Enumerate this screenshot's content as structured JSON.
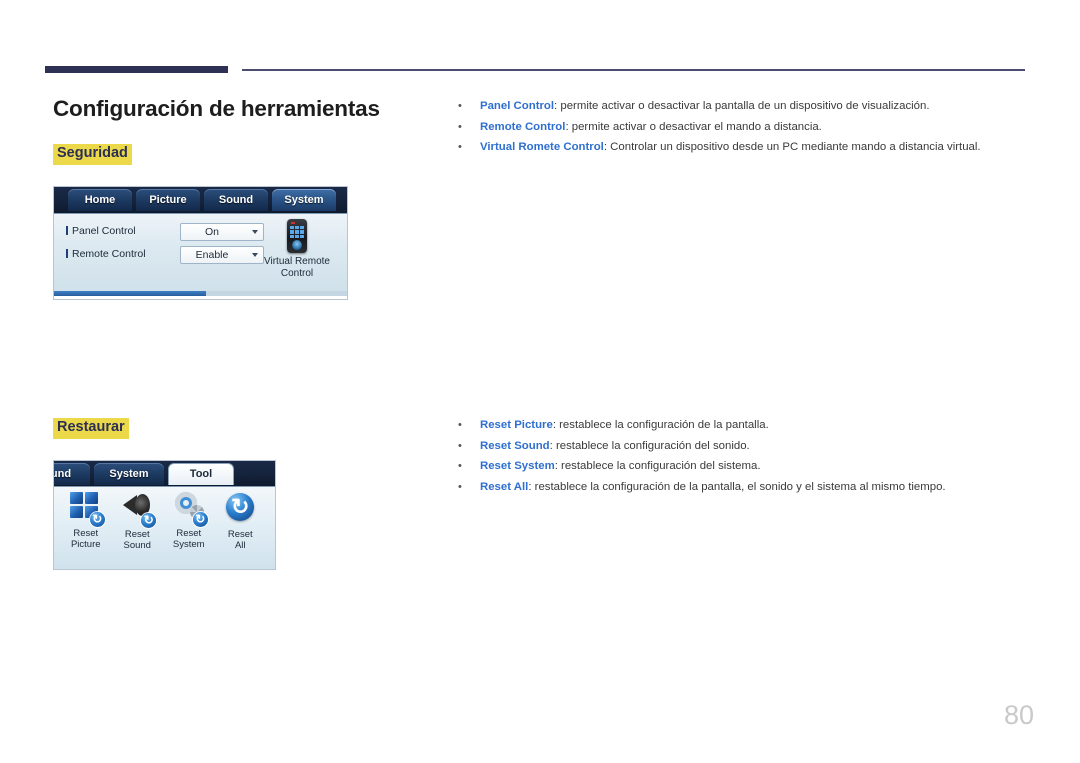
{
  "document": {
    "page_number": "80",
    "title": "Configuración de herramientas"
  },
  "sections": [
    {
      "label": "Seguridad",
      "bullets": [
        {
          "term": "Panel Control",
          "desc": ": permite activar o desactivar la pantalla de un dispositivo de visualización."
        },
        {
          "term": "Remote Control",
          "desc": ": permite activar o desactivar el mando a distancia."
        },
        {
          "term": "Virtual Romete Control",
          "desc": ": Controlar un dispositivo desde un PC mediante mando a distancia virtual."
        }
      ]
    },
    {
      "label": "Restaurar",
      "bullets": [
        {
          "term": "Reset Picture",
          "desc": ": restablece la configuración de la pantalla."
        },
        {
          "term": "Reset Sound",
          "desc": ": restablece la configuración del sonido."
        },
        {
          "term": "Reset System",
          "desc": ": restablece la configuración del sistema."
        },
        {
          "term": "Reset All",
          "desc": ": restablece la configuración de la pantalla, el sonido y el sistema al mismo tiempo."
        }
      ]
    }
  ],
  "screenshot_security": {
    "tabs": [
      {
        "label": "Home",
        "selected": false
      },
      {
        "label": "Picture",
        "selected": false
      },
      {
        "label": "Sound",
        "selected": false
      },
      {
        "label": "System",
        "selected": true
      }
    ],
    "fields": [
      {
        "label": "Panel Control",
        "value": "On"
      },
      {
        "label": "Remote Control",
        "value": "Enable"
      }
    ],
    "virtual_remote": {
      "icon": "remote-control-icon",
      "label_line1": "Virtual Remote",
      "label_line2": "Control"
    }
  },
  "screenshot_reset": {
    "tabs": [
      {
        "label": "und",
        "selected": false,
        "active": false
      },
      {
        "label": "System",
        "selected": false,
        "active": false
      },
      {
        "label": "Tool",
        "selected": false,
        "active": true
      }
    ],
    "items": [
      {
        "icon": "reset-picture-icon",
        "line1": "Reset",
        "line2": "Picture"
      },
      {
        "icon": "reset-sound-icon",
        "line1": "Reset",
        "line2": "Sound"
      },
      {
        "icon": "reset-system-icon",
        "line1": "Reset",
        "line2": "System"
      },
      {
        "icon": "reset-all-icon",
        "line1": "Reset",
        "line2": "All"
      }
    ]
  },
  "colors": {
    "rule_dark": "#2e3154",
    "highlight_yellow": "#ecd94a",
    "term_blue": "#2f6fd0",
    "page_number_gray": "#c9c9c9"
  }
}
